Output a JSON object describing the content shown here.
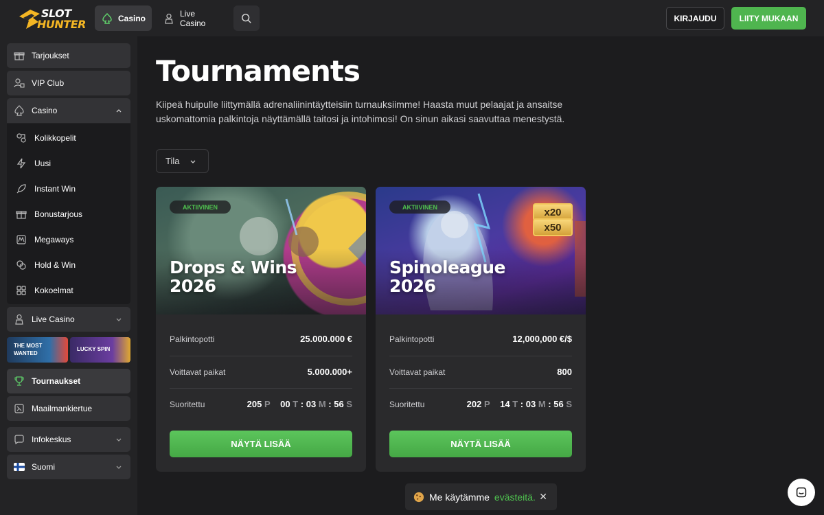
{
  "header": {
    "logo_line1": "SLOT",
    "logo_line2": "HUNTER",
    "nav": [
      {
        "label": "Casino",
        "icon": "spade-icon"
      },
      {
        "label": "Live Casino",
        "icon": "dealer-icon"
      }
    ],
    "login_label": "KIRJAUDU",
    "join_label": "LIITY MUKAAN"
  },
  "sidebar": {
    "items": [
      {
        "label": "Tarjoukset",
        "icon": "gift-icon"
      },
      {
        "label": "VIP Club",
        "icon": "vip-icon"
      },
      {
        "label": "Casino",
        "icon": "spade-icon"
      }
    ],
    "casino_sub": [
      {
        "label": "Kolikkopelit",
        "icon": "slots-icon"
      },
      {
        "label": "Uusi",
        "icon": "lightning-icon"
      },
      {
        "label": "Instant Win",
        "icon": "rocket-icon"
      },
      {
        "label": "Bonustarjous",
        "icon": "gift-icon"
      },
      {
        "label": "Megaways",
        "icon": "megaways-icon"
      },
      {
        "label": "Hold & Win",
        "icon": "coins-icon"
      },
      {
        "label": "Kokoelmat",
        "icon": "grid-icon"
      }
    ],
    "live_casino": "Live Casino",
    "promos": [
      "THE MOST WANTED",
      "LUCKY SPIN"
    ],
    "tournaments": "Tournaukset",
    "world_tour": "Maailmankiertue",
    "info": "Infokeskus",
    "language": "Suomi"
  },
  "main": {
    "title": "Tournaments",
    "description": "Kiipeä huipulle liittymällä adrenaliinintäytteisiin turnauksiimme! Haasta muut pelaajat ja ansaitse uskomattomia palkintoja näyttämällä taitosi ja intohimosi! On sinun aikasi saavuttaa menestystä.",
    "filter_label": "Tila"
  },
  "tournaments": [
    {
      "status": "AKTIIVINEN",
      "name_line1": "Drops & Wins",
      "name_line2": "2026",
      "prize_label": "Palkintopotti",
      "prize_value": "25.000.000 €",
      "places_label": "Voittavat paikat",
      "places_value": "5.000.000+",
      "time_label": "Suoritettu",
      "days": "205",
      "days_unit": "P",
      "hours": "00",
      "hours_unit": "T",
      "minutes": "03",
      "minutes_unit": "M",
      "seconds": "56",
      "seconds_unit": "S",
      "cta": "NÄYTÄ LISÄÄ"
    },
    {
      "status": "AKTIIVINEN",
      "name_line1": "Spinoleague",
      "name_line2": "2026",
      "prize_label": "Palkintopotti",
      "prize_value": "12,000,000 €/$",
      "places_label": "Voittavat paikat",
      "places_value": "800",
      "time_label": "Suoritettu",
      "days": "202",
      "days_unit": "P",
      "hours": "14",
      "hours_unit": "T",
      "minutes": "03",
      "minutes_unit": "M",
      "seconds": "56",
      "seconds_unit": "S",
      "cta": "NÄYTÄ LISÄÄ",
      "multipliers": [
        "x20",
        "x50"
      ]
    }
  ],
  "cookie": {
    "text": "Me käytämme",
    "link": "evästeitä."
  },
  "colors": {
    "accent_green": "#4fb54f",
    "logo_gold": "#f4b624",
    "background": "#1c1c1e",
    "panel": "#232325"
  }
}
